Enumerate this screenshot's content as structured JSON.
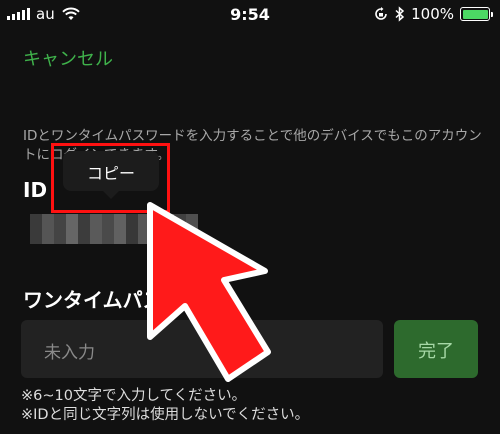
{
  "status_bar": {
    "carrier": "au",
    "time": "9:54",
    "battery_percent": "100%",
    "battery_level": 1.0,
    "icons": [
      "signal-bars-icon",
      "wifi-icon",
      "orientation-lock-icon",
      "bluetooth-icon",
      "battery-icon"
    ]
  },
  "nav": {
    "cancel_label": "キャンセル"
  },
  "description": "IDとワンタイムパスワードを入力することで他のデバイスでもこのアカウントにログインできます。",
  "id_section": {
    "label": "ID"
  },
  "context_menu": {
    "copy_label": "コピー"
  },
  "password_section": {
    "label": "ワンタイムパスワード",
    "placeholder": "未入力",
    "done_label": "完了"
  },
  "notes": [
    "※6~10文字で入力してください。",
    "※IDと同じ文字列は使用しないでください。"
  ],
  "colors": {
    "accent_green": "#3fb24b",
    "done_button": "#2d6a2d",
    "highlight_red": "#ff1111",
    "background": "#111111"
  }
}
